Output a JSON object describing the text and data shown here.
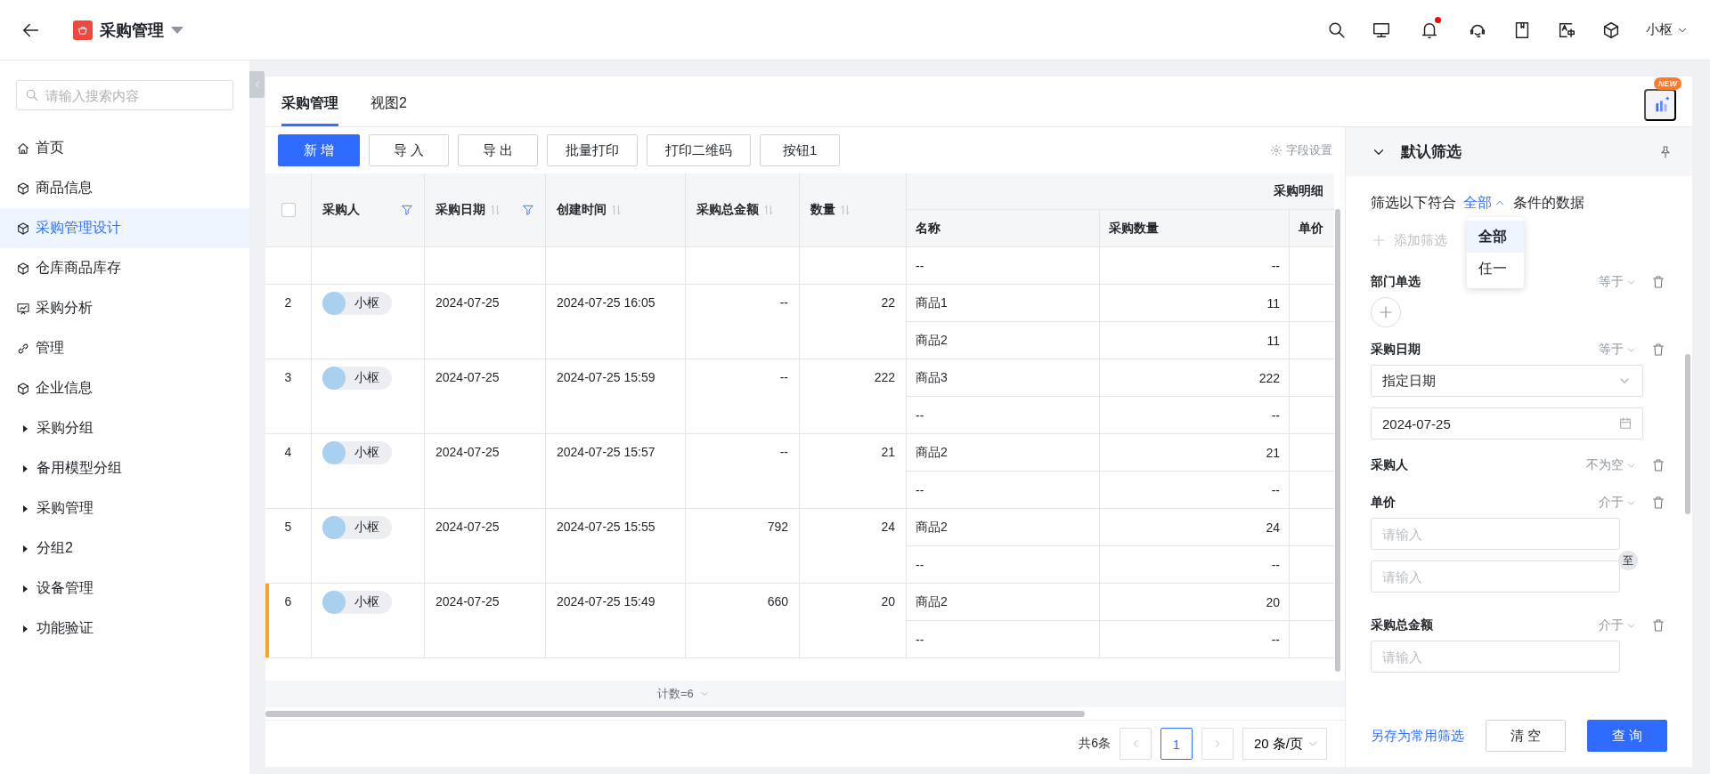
{
  "topbar": {
    "title": "采购管理",
    "user": "小枢",
    "notification_dot": true
  },
  "sidebar": {
    "search": {
      "placeholder": "请输入搜索内容"
    },
    "items": [
      {
        "label": "首页",
        "kind": "home",
        "selected": false
      },
      {
        "label": "商品信息",
        "kind": "form",
        "selected": false
      },
      {
        "label": "采购管理设计",
        "kind": "form",
        "selected": true
      },
      {
        "label": "仓库商品库存",
        "kind": "form",
        "selected": false
      },
      {
        "label": "采购分析",
        "kind": "dashboard",
        "selected": false
      },
      {
        "label": "管理",
        "kind": "link",
        "selected": false
      },
      {
        "label": "企业信息",
        "kind": "form",
        "selected": false
      },
      {
        "label": "采购分组",
        "kind": "group",
        "selected": false
      },
      {
        "label": "备用模型分组",
        "kind": "group",
        "selected": false
      },
      {
        "label": "采购管理",
        "kind": "group",
        "selected": false
      },
      {
        "label": "分组2",
        "kind": "group",
        "selected": false
      },
      {
        "label": "设备管理",
        "kind": "group",
        "selected": false
      },
      {
        "label": "功能验证",
        "kind": "group",
        "selected": false
      }
    ]
  },
  "tabs": [
    {
      "label": "采购管理",
      "selected": true
    },
    {
      "label": "视图2",
      "selected": false
    }
  ],
  "new_badge": "NEW",
  "toolbar": {
    "buttons": [
      {
        "label": "新 增",
        "kind": "primary"
      },
      {
        "label": "导 入",
        "kind": "default"
      },
      {
        "label": "导 出",
        "kind": "default"
      },
      {
        "label": "批量打印",
        "kind": "default"
      },
      {
        "label": "打印二维码",
        "kind": "default"
      },
      {
        "label": "按钮1",
        "kind": "default"
      }
    ],
    "field_settings": "字段设置"
  },
  "table": {
    "select_all": {
      "checked": false
    },
    "columns": [
      {
        "label": "采购人",
        "sortable": false,
        "filtered": true
      },
      {
        "label": "采购日期",
        "sortable": true,
        "filtered": true
      },
      {
        "label": "创建时间",
        "sortable": true,
        "filtered": false
      },
      {
        "label": "采购总金额",
        "sortable": true,
        "filtered": false
      },
      {
        "label": "数量",
        "sortable": true,
        "filtered": false
      }
    ],
    "group_header": "采购明细",
    "detail_columns": [
      "名称",
      "采购数量",
      "单价"
    ],
    "rows": [
      {
        "highlighted": false,
        "details": [
          {
            "name": "--",
            "quantity": "--"
          }
        ]
      },
      {
        "index": "2",
        "buyer": "小枢",
        "date": "2024-07-25",
        "created": "2024-07-25 16:05",
        "total": "--",
        "quantity": "22",
        "highlighted": false,
        "details": [
          {
            "name": "商品1",
            "quantity": "11"
          },
          {
            "name": "商品2",
            "quantity": "11"
          }
        ]
      },
      {
        "index": "3",
        "buyer": "小枢",
        "date": "2024-07-25",
        "created": "2024-07-25 15:59",
        "total": "--",
        "quantity": "222",
        "highlighted": false,
        "details": [
          {
            "name": "商品3",
            "quantity": "222"
          },
          {
            "name": "--",
            "quantity": "--"
          }
        ]
      },
      {
        "index": "4",
        "buyer": "小枢",
        "date": "2024-07-25",
        "created": "2024-07-25 15:57",
        "total": "--",
        "quantity": "21",
        "highlighted": false,
        "details": [
          {
            "name": "商品2",
            "quantity": "21"
          },
          {
            "name": "--",
            "quantity": "--"
          }
        ]
      },
      {
        "index": "5",
        "buyer": "小枢",
        "date": "2024-07-25",
        "created": "2024-07-25 15:55",
        "total": "792",
        "quantity": "24",
        "highlighted": false,
        "details": [
          {
            "name": "商品2",
            "quantity": "24"
          },
          {
            "name": "--",
            "quantity": "--"
          }
        ]
      },
      {
        "index": "6",
        "buyer": "小枢",
        "date": "2024-07-25",
        "created": "2024-07-25 15:49",
        "total": "660",
        "quantity": "20",
        "highlighted": true,
        "details": [
          {
            "name": "商品2",
            "quantity": "20"
          },
          {
            "name": "--",
            "quantity": "--"
          }
        ]
      }
    ]
  },
  "summary": {
    "label": "计数=6"
  },
  "pagination": {
    "total": "共6条",
    "pages": [
      {
        "label": "1",
        "selected": true
      }
    ],
    "page_size": "20 条/页"
  },
  "filter_panel": {
    "title": "默认筛选",
    "match": {
      "prefix": "筛选以下符合",
      "value": "全部",
      "suffix": "条件的数据",
      "options": [
        {
          "label": "全部",
          "selected": true
        },
        {
          "label": "任一",
          "selected": false
        }
      ]
    },
    "add_filter": "添加筛选",
    "conditions": [
      {
        "label": "部门单选",
        "operator": "等于",
        "kind": "member"
      },
      {
        "label": "采购日期",
        "operator": "等于",
        "kind": "date",
        "select": "指定日期",
        "value": "2024-07-25"
      },
      {
        "label": "采购人",
        "operator": "不为空",
        "kind": "none"
      },
      {
        "label": "单价",
        "operator": "介于",
        "kind": "range",
        "placeholders": [
          "请输入",
          "请输入"
        ],
        "connector": "至"
      },
      {
        "label": "采购总金额",
        "operator": "介于",
        "kind": "range",
        "placeholders": [
          "请输入"
        ]
      }
    ],
    "save_link": "另存为常用筛选",
    "buttons": [
      {
        "label": "清 空",
        "kind": "default"
      },
      {
        "label": "查 询",
        "kind": "primary"
      }
    ]
  }
}
